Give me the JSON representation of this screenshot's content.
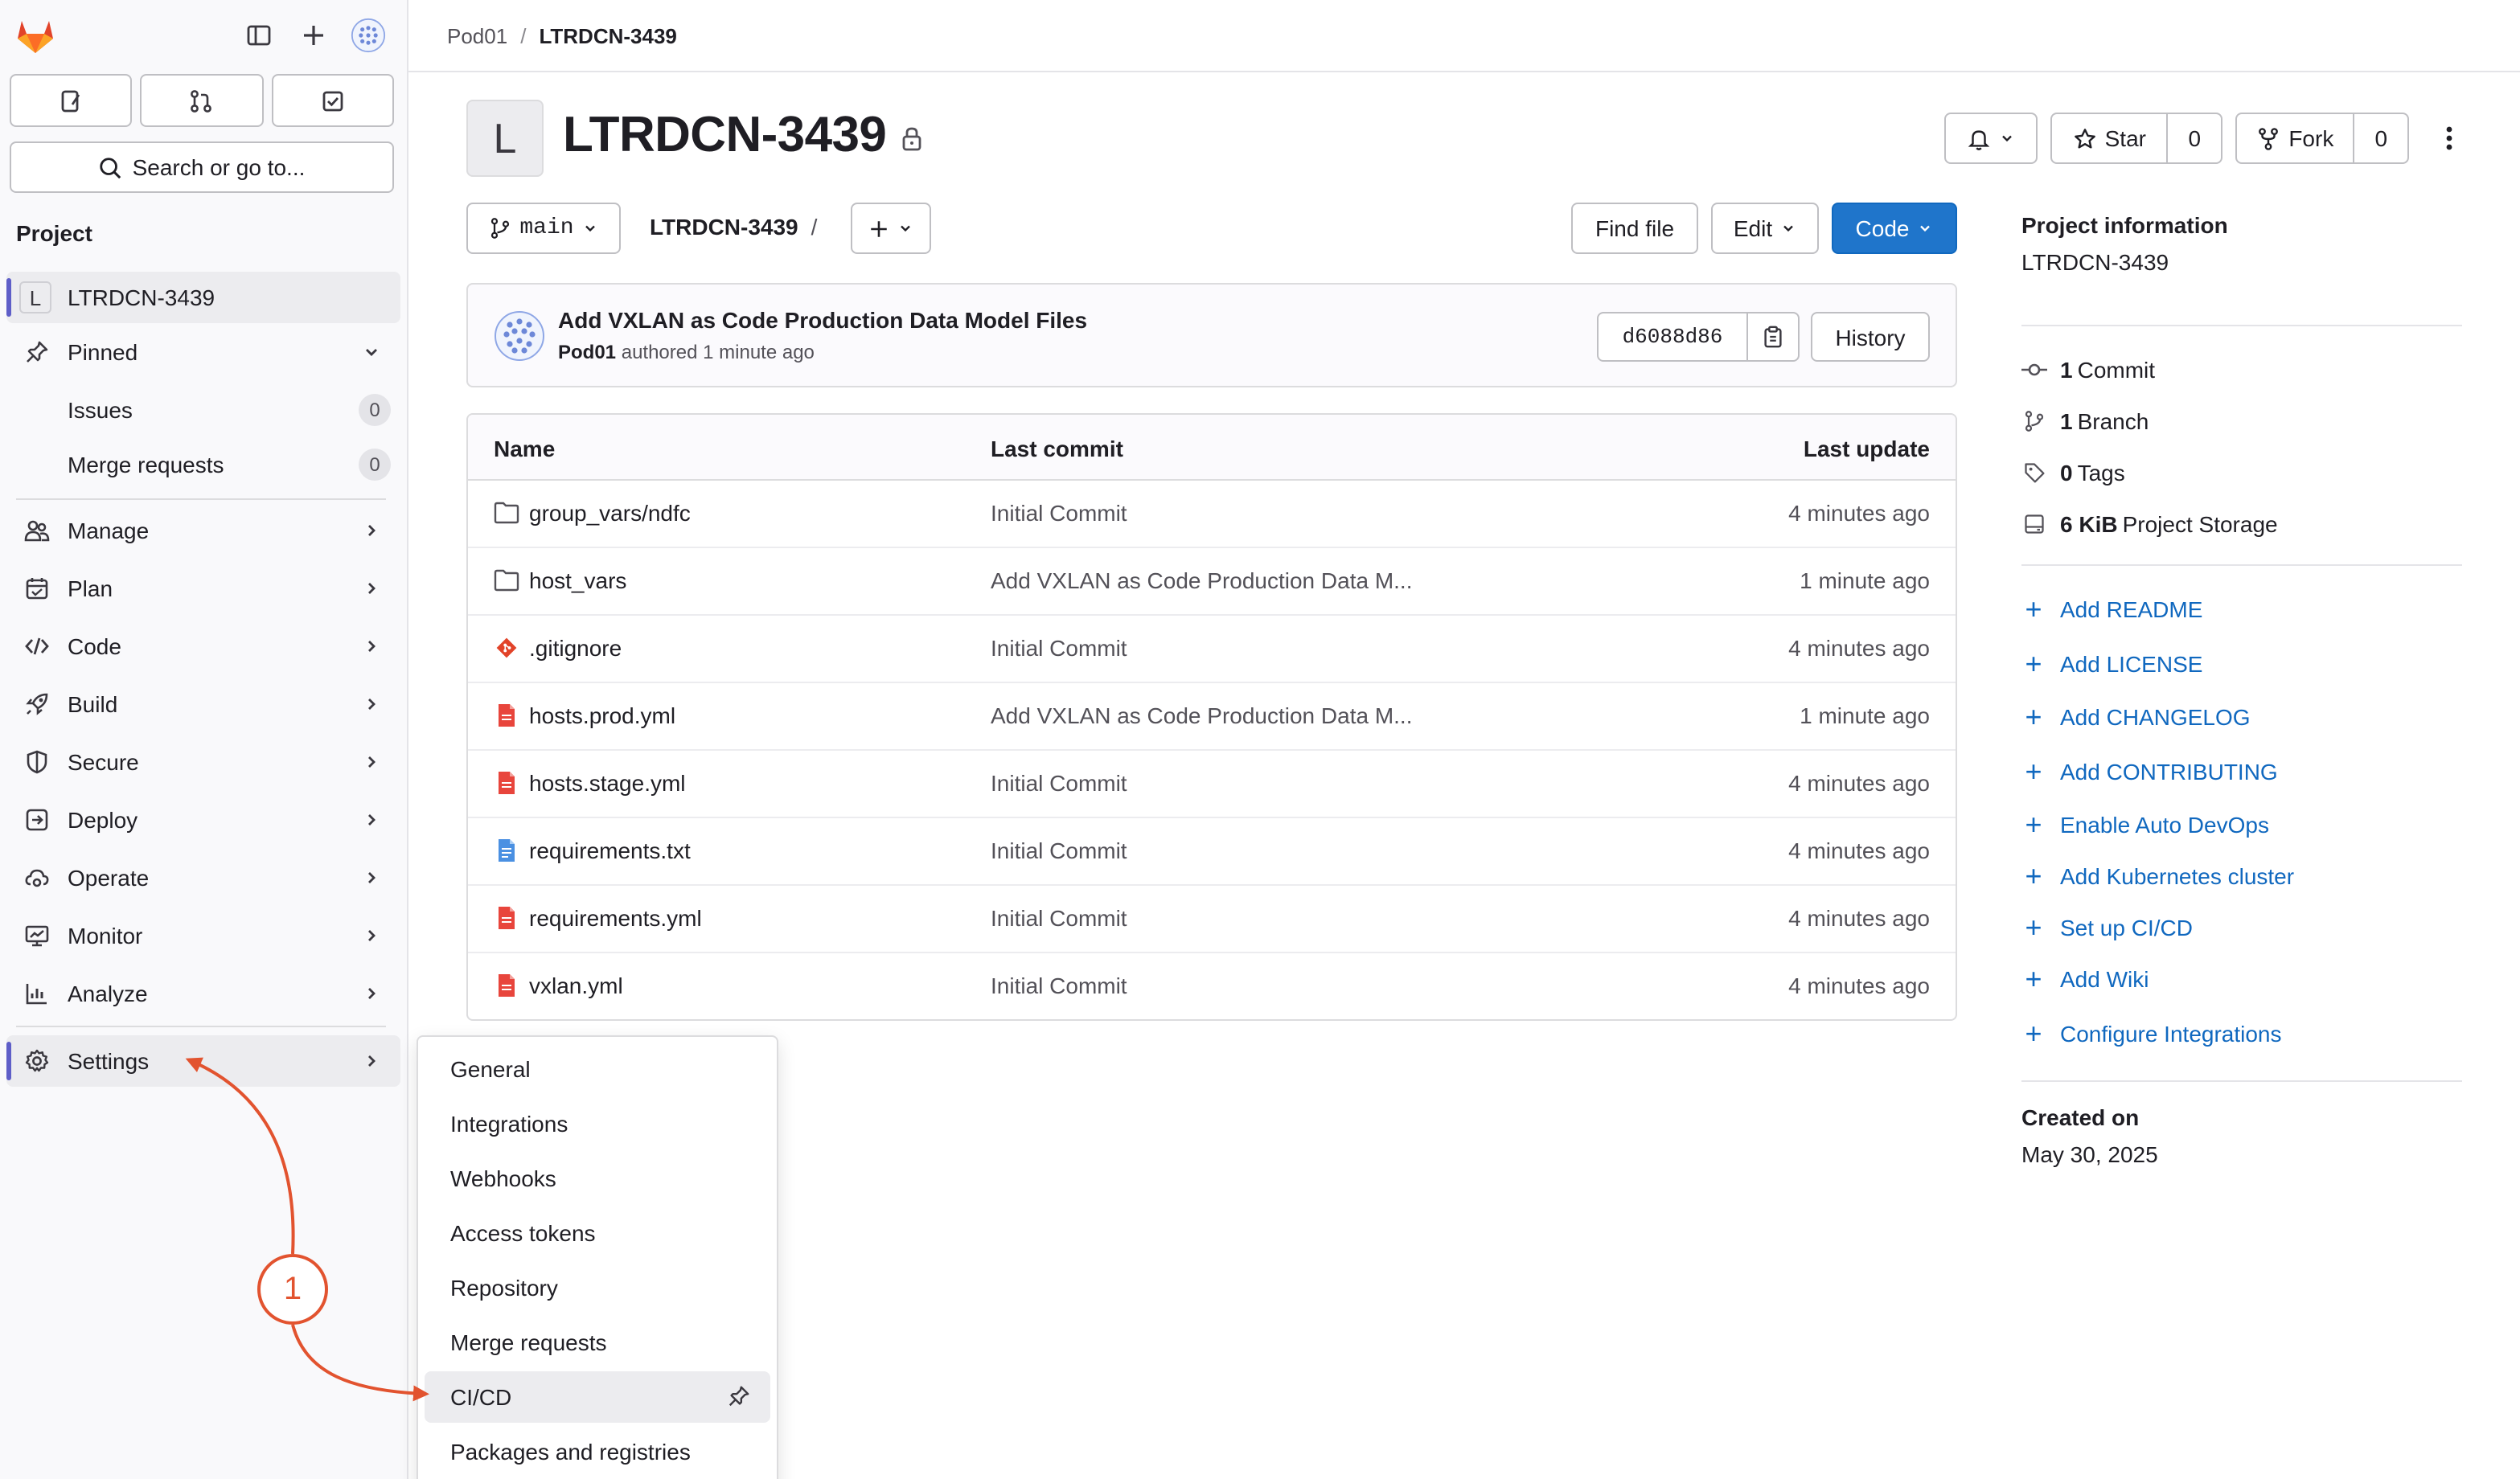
{
  "breadcrumb": {
    "group": "Pod01",
    "separator": "/",
    "project": "LTRDCN-3439"
  },
  "sidebar": {
    "search_label": "Search or go to...",
    "section_title": "Project",
    "project_item": {
      "initial": "L",
      "label": "LTRDCN-3439"
    },
    "pinned": {
      "label": "Pinned",
      "items": [
        {
          "label": "Issues",
          "count": "0"
        },
        {
          "label": "Merge requests",
          "count": "0"
        }
      ]
    },
    "nav": [
      {
        "label": "Manage",
        "icon": "users-icon"
      },
      {
        "label": "Plan",
        "icon": "calendar-icon"
      },
      {
        "label": "Code",
        "icon": "code-icon"
      },
      {
        "label": "Build",
        "icon": "rocket-icon"
      },
      {
        "label": "Secure",
        "icon": "shield-icon"
      },
      {
        "label": "Deploy",
        "icon": "deploy-icon"
      },
      {
        "label": "Operate",
        "icon": "cloud-gear-icon"
      },
      {
        "label": "Monitor",
        "icon": "monitor-icon"
      },
      {
        "label": "Analyze",
        "icon": "chart-icon"
      }
    ],
    "settings_label": "Settings"
  },
  "project": {
    "initial": "L",
    "title": "LTRDCN-3439",
    "star_label": "Star",
    "star_count": "0",
    "fork_label": "Fork",
    "fork_count": "0"
  },
  "repo_toolbar": {
    "branch": "main",
    "path": "LTRDCN-3439",
    "path_sep": "/",
    "find_file": "Find file",
    "edit": "Edit",
    "code": "Code"
  },
  "last_commit": {
    "title": "Add VXLAN as Code Production Data Model Files",
    "author": "Pod01",
    "meta": "authored 1 minute ago",
    "sha": "d6088d86",
    "history": "History"
  },
  "file_table": {
    "headers": {
      "name": "Name",
      "last_commit": "Last commit",
      "last_update": "Last update"
    },
    "rows": [
      {
        "name": "group_vars/ndfc",
        "type": "folder",
        "commit": "Initial Commit",
        "update": "4 minutes ago"
      },
      {
        "name": "host_vars",
        "type": "folder",
        "commit": "Add VXLAN as Code Production Data M...",
        "update": "1 minute ago"
      },
      {
        "name": ".gitignore",
        "type": "git",
        "commit": "Initial Commit",
        "update": "4 minutes ago"
      },
      {
        "name": "hosts.prod.yml",
        "type": "yaml",
        "commit": "Add VXLAN as Code Production Data M...",
        "update": "1 minute ago"
      },
      {
        "name": "hosts.stage.yml",
        "type": "yaml",
        "commit": "Initial Commit",
        "update": "4 minutes ago"
      },
      {
        "name": "requirements.txt",
        "type": "text",
        "commit": "Initial Commit",
        "update": "4 minutes ago"
      },
      {
        "name": "requirements.yml",
        "type": "yaml",
        "commit": "Initial Commit",
        "update": "4 minutes ago"
      },
      {
        "name": "vxlan.yml",
        "type": "yaml",
        "commit": "Initial Commit",
        "update": "4 minutes ago"
      }
    ]
  },
  "project_info": {
    "title": "Project information",
    "name": "LTRDCN-3439",
    "stats": [
      {
        "count": "1",
        "label": "Commit"
      },
      {
        "count": "1",
        "label": "Branch"
      },
      {
        "count": "0",
        "label": "Tags"
      },
      {
        "count": "6 KiB",
        "label": "Project Storage"
      }
    ],
    "actions": [
      "Add README",
      "Add LICENSE",
      "Add CHANGELOG",
      "Add CONTRIBUTING",
      "Enable Auto DevOps",
      "Add Kubernetes cluster",
      "Set up CI/CD",
      "Add Wiki",
      "Configure Integrations"
    ],
    "created_title": "Created on",
    "created_date": "May 30, 2025"
  },
  "settings_menu": {
    "items": [
      "General",
      "Integrations",
      "Webhooks",
      "Access tokens",
      "Repository",
      "Merge requests",
      "CI/CD",
      "Packages and registries"
    ],
    "highlighted": "CI/CD"
  },
  "annotation": {
    "number": "1",
    "color": "#e2532f"
  },
  "colors": {
    "primary": "#1f75cb",
    "link": "#1068bf",
    "file_yaml": "#dd2b0e",
    "file_text": "#1f75cb"
  }
}
